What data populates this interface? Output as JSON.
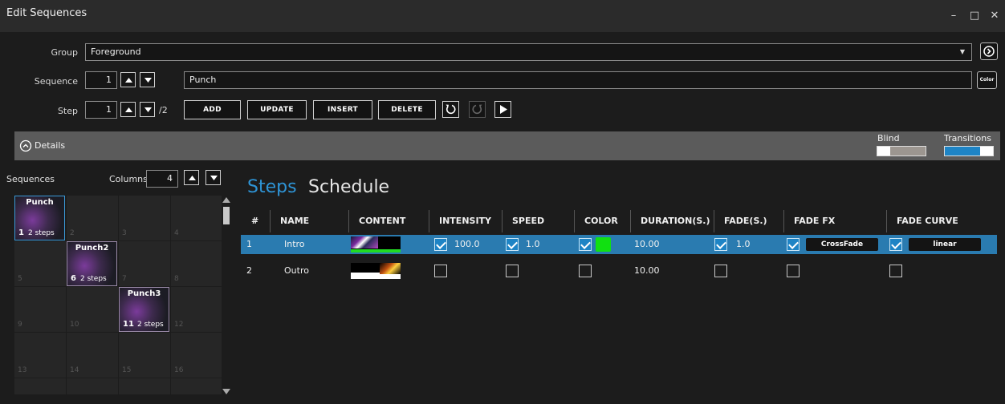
{
  "window": {
    "title": "Edit Sequences",
    "minimize": "–",
    "maximize": "□",
    "close": "✕"
  },
  "group": {
    "label": "Group",
    "value": "Foreground"
  },
  "sequence": {
    "label": "Sequence",
    "number": "1",
    "name": "Punch",
    "color_button": "Color"
  },
  "step": {
    "label": "Step",
    "number": "1",
    "total": "/2"
  },
  "actions": {
    "add": "ADD",
    "update": "UPDATE",
    "insert": "INSERT",
    "delete": "DELETE"
  },
  "details": {
    "label": "Details",
    "blind": "Blind",
    "transitions": "Transitions"
  },
  "left": {
    "sequences_label": "Sequences",
    "columns_label": "Columns",
    "columns_value": "4",
    "cells": [
      {
        "num": "1",
        "name": "Punch",
        "steps": "2 steps",
        "kind": "seq"
      },
      {
        "num": "2"
      },
      {
        "num": "3"
      },
      {
        "num": "4"
      },
      {
        "num": "5"
      },
      {
        "num": "6",
        "name": "Punch2",
        "steps": "2 steps",
        "kind": "seq"
      },
      {
        "num": "7"
      },
      {
        "num": "8"
      },
      {
        "num": "9"
      },
      {
        "num": "10"
      },
      {
        "num": "11",
        "name": "Punch3",
        "steps": "2 steps",
        "kind": "seq"
      },
      {
        "num": "12"
      },
      {
        "num": "13"
      },
      {
        "num": "14"
      },
      {
        "num": "15"
      },
      {
        "num": "16"
      }
    ]
  },
  "tabs": {
    "steps": "Steps",
    "schedule": "Schedule"
  },
  "table": {
    "headers": [
      "#",
      "NAME",
      "CONTENT",
      "INTENSITY",
      "SPEED",
      "COLOR",
      "DURATION(S.)",
      "FADE(S.)",
      "FADE FX",
      "FADE CURVE"
    ],
    "rows": [
      {
        "num": "1",
        "name": "Intro",
        "intensity_on": true,
        "intensity": "100.0",
        "speed_on": true,
        "speed": "1.0",
        "color_on": true,
        "color": "#11e011",
        "duration": "10.00",
        "fade_on": true,
        "fade": "1.0",
        "fadefx_on": true,
        "fadefx": "CrossFade",
        "curve_on": true,
        "curve": "linear",
        "selected": true
      },
      {
        "num": "2",
        "name": "Outro",
        "intensity_on": false,
        "intensity": "",
        "speed_on": false,
        "speed": "",
        "color_on": false,
        "color": "",
        "duration": "10.00",
        "fade_on": false,
        "fade": "",
        "fadefx_on": false,
        "fadefx": "",
        "curve_on": false,
        "curve": "",
        "selected": false
      }
    ]
  },
  "colors": {
    "accent": "#1e84c5",
    "selected_row": "#2a7bb0",
    "titlebar": "#2b2b2b",
    "window": "#1c1c1c",
    "details_bar": "#5b5b5b"
  }
}
